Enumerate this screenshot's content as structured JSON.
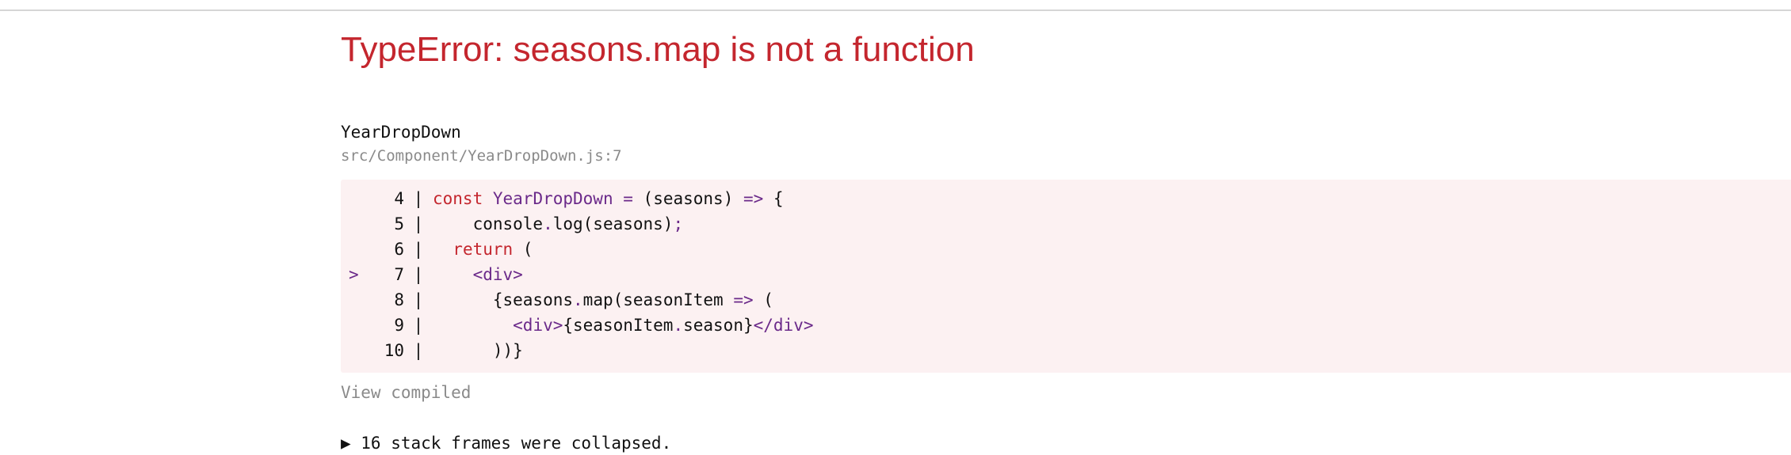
{
  "error": {
    "title": "TypeError: seasons.map is not a function",
    "component": "YearDropDown",
    "location": "src/Component/YearDropDown.js:7"
  },
  "code": {
    "highlighted_line": "7",
    "marker": ">",
    "separator": "|",
    "lines": [
      {
        "number": "4",
        "tokens": [
          {
            "t": "const",
            "c": "kw"
          },
          {
            "t": " ",
            "c": "plain"
          },
          {
            "t": "YearDropDown",
            "c": "fn"
          },
          {
            "t": " ",
            "c": "plain"
          },
          {
            "t": "=",
            "c": "punc"
          },
          {
            "t": " (seasons) ",
            "c": "plain"
          },
          {
            "t": "=>",
            "c": "punc"
          },
          {
            "t": " {",
            "c": "plain"
          }
        ]
      },
      {
        "number": "5",
        "tokens": [
          {
            "t": "    console",
            "c": "plain"
          },
          {
            "t": ".",
            "c": "punc"
          },
          {
            "t": "log(seasons)",
            "c": "plain"
          },
          {
            "t": ";",
            "c": "punc"
          }
        ]
      },
      {
        "number": "6",
        "tokens": [
          {
            "t": "  ",
            "c": "plain"
          },
          {
            "t": "return",
            "c": "kw"
          },
          {
            "t": " (",
            "c": "plain"
          }
        ]
      },
      {
        "number": "7",
        "tokens": [
          {
            "t": "    ",
            "c": "plain"
          },
          {
            "t": "<div>",
            "c": "tag"
          }
        ]
      },
      {
        "number": "8",
        "tokens": [
          {
            "t": "      {seasons",
            "c": "plain"
          },
          {
            "t": ".",
            "c": "punc"
          },
          {
            "t": "map(seasonItem ",
            "c": "plain"
          },
          {
            "t": "=>",
            "c": "punc"
          },
          {
            "t": " (",
            "c": "plain"
          }
        ]
      },
      {
        "number": "9",
        "tokens": [
          {
            "t": "        ",
            "c": "plain"
          },
          {
            "t": "<div>",
            "c": "tag"
          },
          {
            "t": "{seasonItem",
            "c": "plain"
          },
          {
            "t": ".",
            "c": "punc"
          },
          {
            "t": "season}",
            "c": "plain"
          },
          {
            "t": "</div>",
            "c": "tag"
          }
        ]
      },
      {
        "number": "10",
        "tokens": [
          {
            "t": "      ))}",
            "c": "plain"
          }
        ]
      }
    ]
  },
  "actions": {
    "view_compiled": "View compiled",
    "stack_frames": "▶ 16 stack frames were collapsed."
  },
  "colors": {
    "error_red": "#c4262e",
    "code_bg": "#fcf1f2",
    "muted_gray": "#8a8a8a",
    "syntax_purple": "#6b2a8a"
  }
}
